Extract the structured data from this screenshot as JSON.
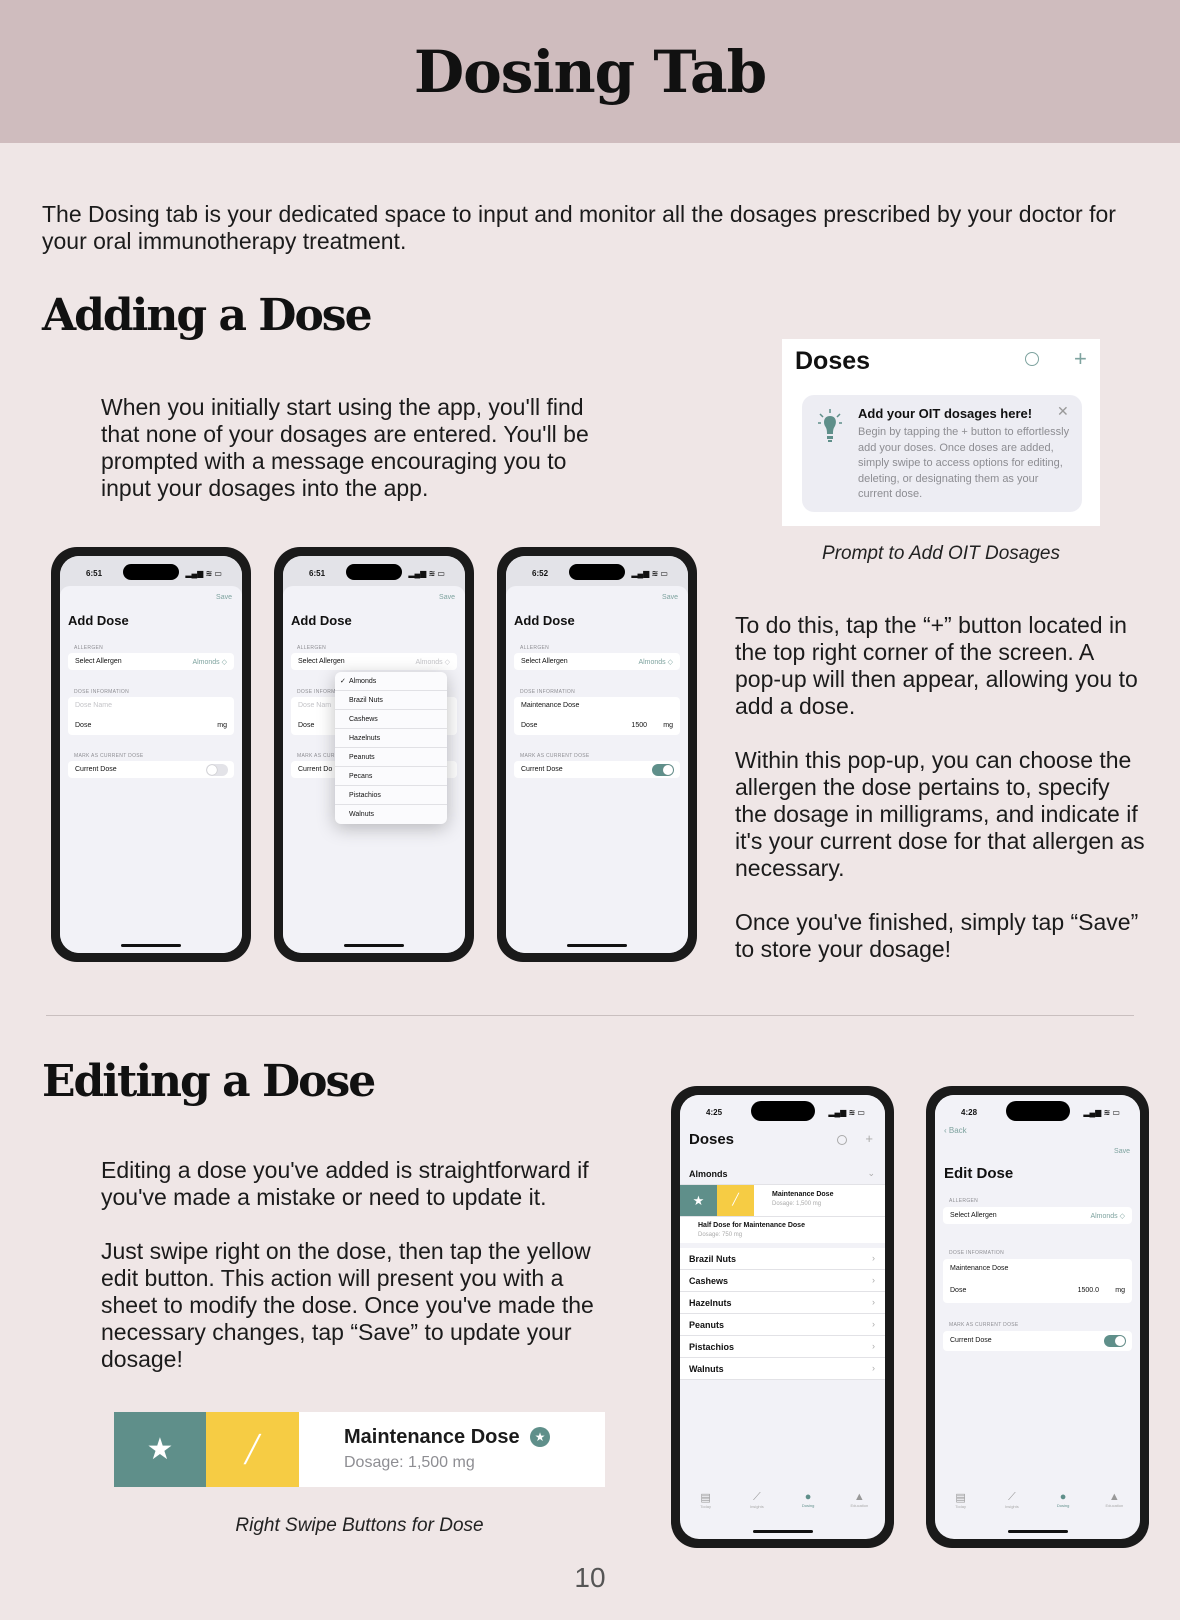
{
  "header": {
    "title": "Dosing Tab"
  },
  "intro": "The Dosing tab is your dedicated space to input and monitor all the dosages prescribed by your doctor for your oral immunotherapy treatment.",
  "adding": {
    "heading": "Adding a Dose",
    "para1": "When you initially start using the app, you'll find that none of your dosages are entered. You'll be prompted with a message encouraging you to input your dosages into the app.",
    "para2": "To do this, tap the “+” button located in the top right corner of the screen. A pop-up will then appear, allowing you to add a dose.",
    "para3": "Within this pop-up, you can choose the allergen the dose pertains to, specify the dosage in milligrams, and indicate if it's your current dose for that allergen as necessary.",
    "para4": "Once you've finished, simply tap “Save” to store your dosage!",
    "prompt_caption": "Prompt to Add OIT Dosages"
  },
  "prompt_card": {
    "title": "Doses",
    "tip_title": "Add your OIT dosages here!",
    "tip_body": "Begin by tapping the + button to effortlessly add your doses. Once doses are added, simply swipe to access options for editing, deleting, or designating them as your current dose.",
    "plus": "+",
    "close": "✕"
  },
  "add_phone_1": {
    "time": "6:51",
    "save": "Save",
    "title": "Add Dose",
    "allergen_section": "ALLERGEN",
    "select_allergen": "Select Allergen",
    "allergen_value": "Almonds ◇",
    "dose_section": "DOSE INFORMATION",
    "dose_name_placeholder": "Dose Name",
    "dose_label": "Dose",
    "unit": "mg",
    "current_section": "MARK AS CURRENT DOSE",
    "current_label": "Current Dose"
  },
  "add_phone_2": {
    "time": "6:51",
    "save": "Save",
    "title": "Add Dose",
    "allergen_section": "ALLERGEN",
    "select_allergen": "Select Allergen",
    "allergen_value": "Almonds ◇",
    "dose_section": "DOSE INFORM",
    "dose_name_placeholder": "Dose Nam",
    "dose_label": "Dose",
    "current_section": "MARK AS CUR",
    "current_label": "Current Do",
    "options": [
      "Almonds",
      "Brazil Nuts",
      "Cashews",
      "Hazelnuts",
      "Peanuts",
      "Pecans",
      "Pistachios",
      "Walnuts"
    ]
  },
  "add_phone_3": {
    "time": "6:52",
    "save": "Save",
    "title": "Add Dose",
    "allergen_section": "ALLERGEN",
    "select_allergen": "Select Allergen",
    "allergen_value": "Almonds ◇",
    "dose_section": "DOSE INFORMATION",
    "dose_name": "Maintenance Dose",
    "dose_label": "Dose",
    "dose_value": "1500",
    "unit": "mg",
    "current_section": "MARK AS CURRENT DOSE",
    "current_label": "Current Dose"
  },
  "editing": {
    "heading": "Editing a Dose",
    "para1": "Editing a dose you've added is straightforward if you've made a mistake or need to update it.",
    "para2": "Just swipe right on the dose, then tap the yellow edit button. This action will present you with a sheet to modify the dose. Once you've made the necessary changes, tap “Save” to update your dosage!",
    "swipe_caption": "Right Swipe Buttons for Dose"
  },
  "swipe_bar": {
    "title": "Maintenance Dose",
    "subtitle": "Dosage: 1,500 mg"
  },
  "list_phone": {
    "time": "4:25",
    "title": "Doses",
    "group": "Almonds",
    "swipe_title": "Maintenance Dose",
    "swipe_sub": "Dosage: 1,500 mg",
    "half_title": "Half Dose for Maintenance Dose",
    "half_sub": "Dosage: 750 mg",
    "items": [
      "Brazil Nuts",
      "Cashews",
      "Hazelnuts",
      "Peanuts",
      "Pistachios",
      "Walnuts"
    ],
    "tabs": [
      "Today",
      "Insights",
      "Dosing",
      "Education"
    ]
  },
  "edit_phone": {
    "time": "4:28",
    "back": "Back",
    "save": "Save",
    "title": "Edit Dose",
    "allergen_section": "ALLERGEN",
    "select_allergen": "Select Allergen",
    "allergen_value": "Almonds ◇",
    "dose_section": "DOSE INFORMATION",
    "dose_name": "Maintenance Dose",
    "dose_label": "Dose",
    "dose_value": "1500.0",
    "unit": "mg",
    "current_section": "MARK AS CURRENT DOSE",
    "current_label": "Current Dose",
    "tabs": [
      "Today",
      "Insights",
      "Dosing",
      "Education"
    ]
  },
  "page_number": "10",
  "colors": {
    "header_bg": "#cfbcbe",
    "page_bg": "#efe6e6",
    "accent_teal": "#5f8f8a",
    "accent_yellow": "#f6cc44"
  }
}
